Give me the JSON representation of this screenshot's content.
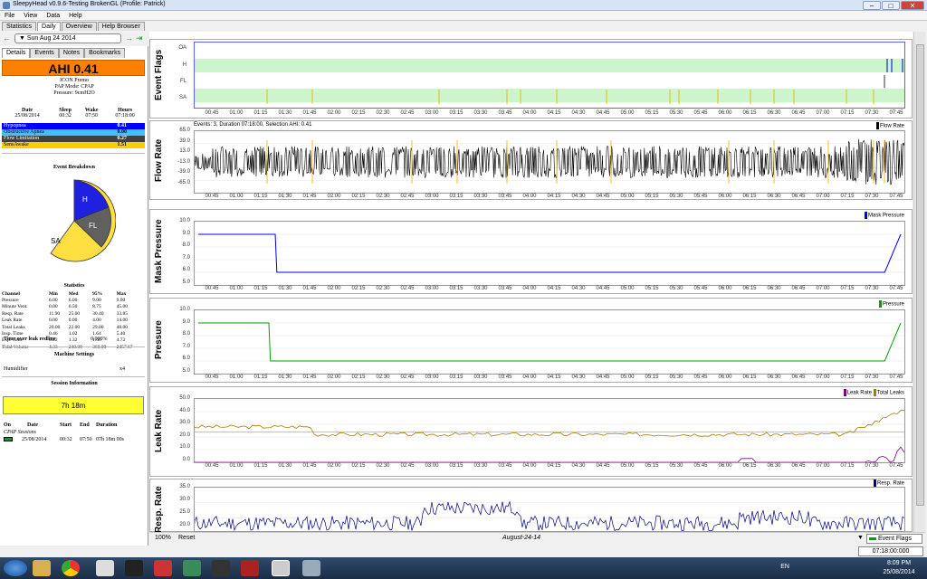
{
  "window": {
    "title": "SleepyHead v0.9.6-Testing BrokenGL (Profile: Patrick)",
    "minimize": "–",
    "maximize": "□",
    "close": "✕"
  },
  "menu": [
    "File",
    "View",
    "Data",
    "Help"
  ],
  "main_tabs": [
    "Statistics",
    "Daily",
    "Overview",
    "Help Browser"
  ],
  "date": {
    "prev": "←",
    "next": "→",
    "value": "▼ Sun Aug 24 2014",
    "jump": "⇥"
  },
  "sub_tabs": [
    "Details",
    "Events",
    "Notes",
    "Bookmarks"
  ],
  "ahi": "AHI 0.41",
  "machine": {
    "name": "ICON Premo",
    "mode": "PAP Mode: CPAP",
    "pressure": "Pressure: 9cmH2O"
  },
  "summary": {
    "headers": [
      "Date",
      "Sleep",
      "Wake",
      "Hours"
    ],
    "values": [
      "25/08/2014",
      "00:32",
      "07:50",
      "07:18:00"
    ]
  },
  "events": [
    {
      "name": "Hypopnea",
      "value": "0.41",
      "color": "#0000ff",
      "text": "#ffffff"
    },
    {
      "name": "Obstructive Apnea",
      "value": "0.00",
      "color": "#40c0ff",
      "text": "#000000"
    },
    {
      "name": "Flow Limitation",
      "value": "0.27",
      "color": "#404040",
      "text": "#ffffff"
    },
    {
      "name": "SensAwake",
      "value": "1.51",
      "color": "#ffcc00",
      "text": "#000000"
    }
  ],
  "breakdown": {
    "title": "Event Breakdown",
    "labels": [
      "H",
      "FL",
      "SA"
    ]
  },
  "stats": {
    "title": "Statistics",
    "headers": [
      "Channel",
      "Min",
      "Med",
      "95%",
      "Max"
    ],
    "rows": [
      [
        "Pressure",
        "6.00",
        "6.00",
        "9.00",
        "9.00"
      ],
      [
        "Minute Vent.",
        "0.00",
        "6.50",
        "8.75",
        "45.00"
      ],
      [
        "Resp. Rate",
        "11.90",
        "25.00",
        "30.40",
        "33.85"
      ],
      [
        "Leak Rate",
        "0.00",
        "0.00",
        "4.00",
        "14.00"
      ],
      [
        "Total Leaks",
        "20.00",
        "22.00",
        "29.00",
        "48.00"
      ],
      [
        "Insp. Time",
        "0.46",
        "1.02",
        "1.64",
        "5.40"
      ],
      [
        "Exp. Time",
        "0.22",
        "1.32",
        "1.66",
        "4.72"
      ],
      [
        "Tidal Volume",
        "4.33",
        "240.00",
        "360.00",
        "2457.67"
      ]
    ]
  },
  "leak_redline": {
    "label": "Time over leak redline",
    "value": "0.000%"
  },
  "machine_settings": {
    "title": "Machine Settings",
    "label": "Humidifier",
    "value": "x4"
  },
  "session_info": {
    "title": "Session Information",
    "duration": "7h 18m"
  },
  "sessions": {
    "headers": [
      "On",
      "Date",
      "Start",
      "End",
      "Duration"
    ],
    "type": "CPAP Sessions",
    "row": [
      "25/08/2014",
      "00:32",
      "07:50",
      "07h 18m 00s"
    ]
  },
  "x_ticks": [
    "00:45",
    "01:00",
    "01:15",
    "01:30",
    "01:45",
    "02:00",
    "02:15",
    "02:30",
    "02:45",
    "03:00",
    "03:15",
    "03:30",
    "03:45",
    "04:00",
    "04:15",
    "04:30",
    "04:45",
    "05:00",
    "05:15",
    "05:30",
    "05:45",
    "06:00",
    "06:15",
    "06:30",
    "06:45",
    "07:00",
    "07:15",
    "07:30",
    "07:45"
  ],
  "panels": {
    "event_flags": {
      "label": "Event Flags",
      "rows": [
        "OA",
        "H",
        "FL",
        "SA"
      ]
    },
    "flow_rate": {
      "label": "Flow Rate",
      "info": "Events: 3, Duration 07:18:00, Selection AHI: 0.41",
      "legend": "Flow Rate",
      "yticks": [
        "65.0",
        "39.0",
        "13.0",
        "-13.0",
        "-39.0",
        "-65.0"
      ]
    },
    "mask_pressure": {
      "label": "Mask Pressure",
      "legend": "Mask Pressure",
      "yticks": [
        "10.0",
        "9.0",
        "8.0",
        "7.0",
        "6.0",
        "5.0"
      ]
    },
    "pressure": {
      "label": "Pressure",
      "legend": "Pressure",
      "yticks": [
        "10.0",
        "9.0",
        "8.0",
        "7.0",
        "6.0",
        "5.0"
      ]
    },
    "leak_rate": {
      "label": "Leak Rate",
      "legend1": "Leak Rate",
      "legend2": "Total Leaks",
      "yticks": [
        "50.0",
        "40.0",
        "30.0",
        "20.0",
        "10.0",
        "0.0"
      ]
    },
    "resp_rate": {
      "label": "Resp. Rate",
      "legend": "Resp. Rate",
      "yticks": [
        "35.0",
        "30.0",
        "25.0",
        "20.0"
      ]
    }
  },
  "bottom": {
    "zoom": "100%",
    "reset": "Reset",
    "date": "August-24-14",
    "combo": "Event Flags"
  },
  "time_readout": "07:18:00:000",
  "tray": {
    "lang": "EN",
    "time": "8:09 PM",
    "date": "25/08/2014"
  },
  "chart_data": [
    {
      "type": "line",
      "title": "Mask Pressure",
      "x": [
        "00:32",
        "01:20",
        "01:21",
        "07:40",
        "07:50"
      ],
      "y": [
        9,
        9,
        6,
        6,
        9
      ],
      "ylim": [
        5,
        10
      ]
    },
    {
      "type": "line",
      "title": "Pressure",
      "x": [
        "00:32",
        "01:16",
        "01:17",
        "07:40",
        "07:50"
      ],
      "y": [
        9,
        9,
        6,
        6,
        9
      ],
      "ylim": [
        5,
        10
      ]
    },
    {
      "type": "line",
      "title": "Leak Rate",
      "series": [
        {
          "name": "Leak Rate",
          "values": [
            0,
            0,
            0,
            0,
            14
          ]
        },
        {
          "name": "Total Leaks",
          "values": [
            28,
            22,
            22,
            22,
            48
          ]
        }
      ],
      "categories": [
        "00:45",
        "03:00",
        "05:00",
        "07:00",
        "07:45"
      ],
      "ylim": [
        0,
        50
      ]
    },
    {
      "type": "line",
      "title": "Resp. Rate",
      "x": [
        "00:45",
        "03:00",
        "05:00",
        "07:00",
        "07:45"
      ],
      "y": [
        25,
        25,
        25,
        22,
        22
      ],
      "ylim": [
        20,
        35
      ]
    }
  ]
}
